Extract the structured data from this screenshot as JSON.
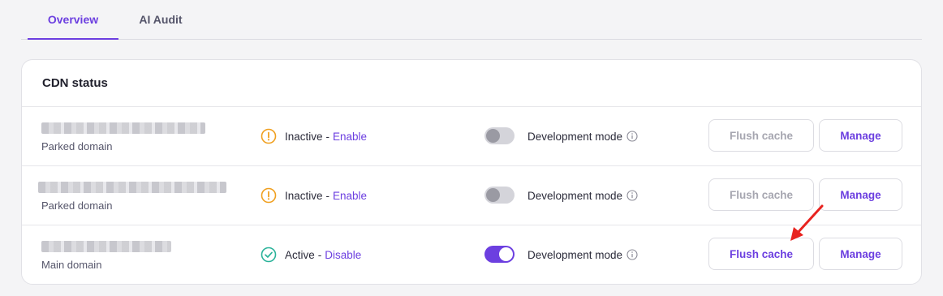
{
  "tabs": [
    {
      "label": "Overview",
      "active": true
    },
    {
      "label": "AI Audit",
      "active": false
    }
  ],
  "card": {
    "title": "CDN status",
    "rows": [
      {
        "domain_name": "",
        "domain_type": "Parked domain",
        "status": "Inactive",
        "status_icon": "warning-circle-icon",
        "status_action": "Enable",
        "dev_mode_label": "Development mode",
        "dev_mode_on": false,
        "flush_label": "Flush cache",
        "flush_enabled": false,
        "manage_label": "Manage"
      },
      {
        "domain_name": "",
        "domain_type": "Parked domain",
        "status": "Inactive",
        "status_icon": "warning-circle-icon",
        "status_action": "Enable",
        "dev_mode_label": "Development mode",
        "dev_mode_on": false,
        "flush_label": "Flush cache",
        "flush_enabled": false,
        "manage_label": "Manage"
      },
      {
        "domain_name": "",
        "domain_type": "Main domain",
        "status": "Active",
        "status_icon": "check-circle-icon",
        "status_action": "Disable",
        "dev_mode_label": "Development mode",
        "dev_mode_on": true,
        "flush_label": "Flush cache",
        "flush_enabled": true,
        "manage_label": "Manage"
      }
    ]
  },
  "separator": "-",
  "colors": {
    "accent": "#6c3fe0",
    "warning": "#f0a020",
    "success": "#2bb39a",
    "annotation_arrow": "#e8231f"
  }
}
